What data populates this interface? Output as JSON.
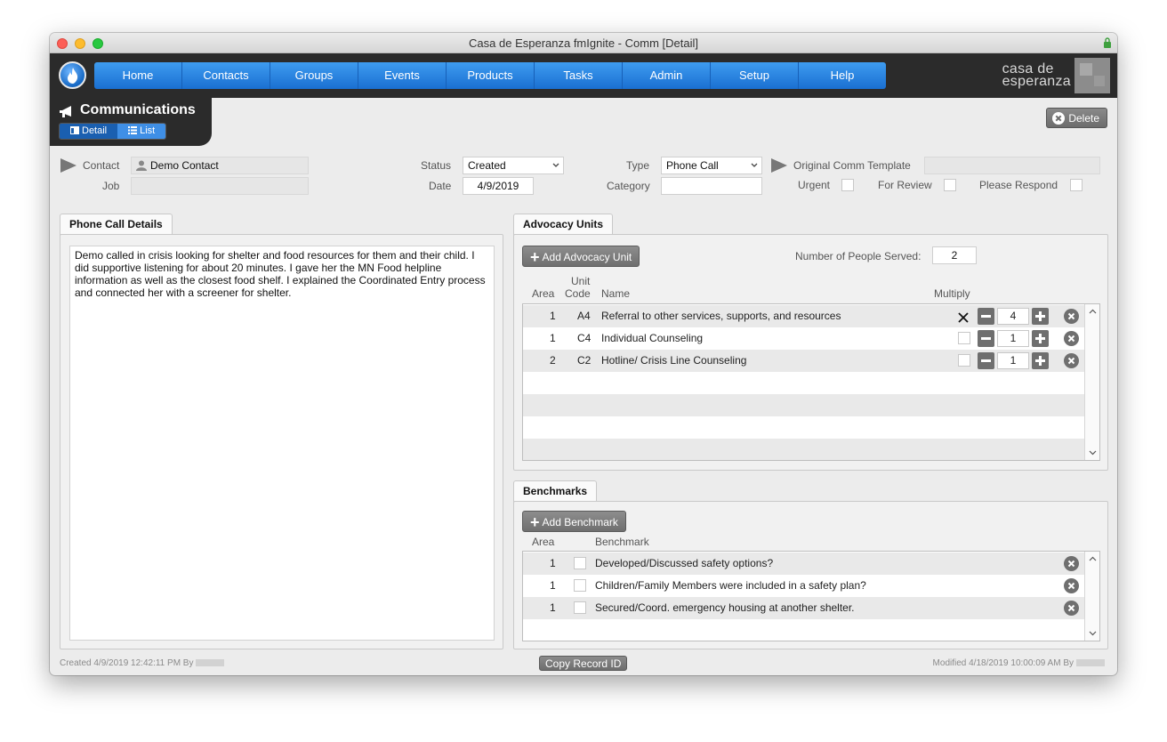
{
  "window": {
    "title": "Casa de Esperanza fmIgnite - Comm [Detail]"
  },
  "nav": {
    "items": [
      "Home",
      "Contacts",
      "Groups",
      "Events",
      "Products",
      "Tasks",
      "Admin",
      "Setup",
      "Help"
    ],
    "brand_line1": "casa de",
    "brand_line2": "esperanza"
  },
  "module": {
    "title": "Communications",
    "view_detail": "Detail",
    "view_list": "List",
    "delete_label": "Delete"
  },
  "form": {
    "contact_label": "Contact",
    "contact_value": "Demo Contact",
    "job_label": "Job",
    "job_value": "",
    "status_label": "Status",
    "status_value": "Created",
    "date_label": "Date",
    "date_value": "4/9/2019",
    "type_label": "Type",
    "type_value": "Phone Call",
    "category_label": "Category",
    "category_value": "",
    "template_label": "Original Comm Template",
    "template_value": "",
    "urgent_label": "Urgent",
    "review_label": "For Review",
    "respond_label": "Please Respond"
  },
  "details": {
    "tab_label": "Phone Call Details",
    "notes": "Demo called in crisis looking for shelter and food resources for them and their child. I did supportive listening for about 20 minutes. I gave her the MN Food helpline information as well as the closest food shelf. I explained the Coordinated Entry process and connected her with a screener for shelter."
  },
  "advocacy": {
    "tab_label": "Advocacy Units",
    "add_label": "Add Advocacy Unit",
    "people_label": "Number of People Served:",
    "people_value": "2",
    "col_area": "Area",
    "col_unit": "Unit",
    "col_code": "Code",
    "col_name": "Name",
    "col_multiply": "Multiply",
    "rows": [
      {
        "area": "1",
        "code": "A4",
        "name": "Referral to other services, supports, and resources",
        "multiply": true,
        "qty": "4"
      },
      {
        "area": "1",
        "code": "C4",
        "name": "Individual Counseling",
        "multiply": false,
        "qty": "1"
      },
      {
        "area": "2",
        "code": "C2",
        "name": "Hotline/ Crisis Line Counseling",
        "multiply": false,
        "qty": "1"
      }
    ]
  },
  "benchmarks": {
    "tab_label": "Benchmarks",
    "add_label": "Add Benchmark",
    "col_area": "Area",
    "col_benchmark": "Benchmark",
    "rows": [
      {
        "area": "1",
        "text": "Developed/Discussed safety options?"
      },
      {
        "area": "1",
        "text": "Children/Family Members were included in a safety plan?"
      },
      {
        "area": "1",
        "text": "Secured/Coord. emergency housing at another shelter."
      }
    ]
  },
  "footer": {
    "created": "Created 4/9/2019 12:42:11 PM By",
    "copy_label": "Copy Record ID",
    "modified": "Modified 4/18/2019 10:00:09 AM By"
  },
  "colors": {
    "nav_blue": "#1a6fd1",
    "dark_bar": "#2b2b2b",
    "button_gray": "#7a7a7a"
  }
}
